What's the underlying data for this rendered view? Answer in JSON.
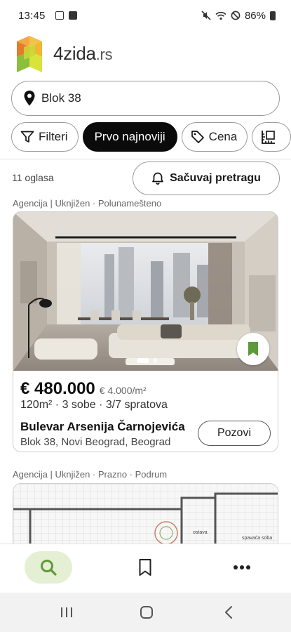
{
  "status_bar": {
    "time": "13:45",
    "battery": "86%"
  },
  "header": {
    "logo_name": "4zida",
    "logo_tld": ".rs"
  },
  "search": {
    "value": "Blok 38"
  },
  "chips": [
    {
      "label": "Filteri",
      "icon": "filter-icon"
    },
    {
      "label": "Prvo najnoviji",
      "active": true
    },
    {
      "label": "Cena",
      "icon": "price-tag-icon"
    },
    {
      "label": "",
      "icon": "area-ruler-icon"
    }
  ],
  "results": {
    "count": "11 oglasa",
    "save_search_label": "Sačuvaj pretragu"
  },
  "listings": [
    {
      "tags": "Agencija | Uknjižen · Polunamešteno",
      "price": "€ 480.000",
      "price_per_m2": "€ 4.000/m²",
      "specs": "120m² · 3 sobe · 3/7 spratova",
      "street": "Bulevar Arsenija Čarnojevića",
      "location": "Blok 38, Novi Beograd, Beograd",
      "call_label": "Pozovi",
      "bookmark_color": "#5e9a3a"
    },
    {
      "tags": "Agencija | Uknjižen · Prazno · Podrum",
      "floorplan_labels": [
        "ostava",
        "spavaća soba"
      ]
    }
  ],
  "colors": {
    "accent": "#5e9a3a",
    "nav_active_bg": "#e4efd4"
  }
}
